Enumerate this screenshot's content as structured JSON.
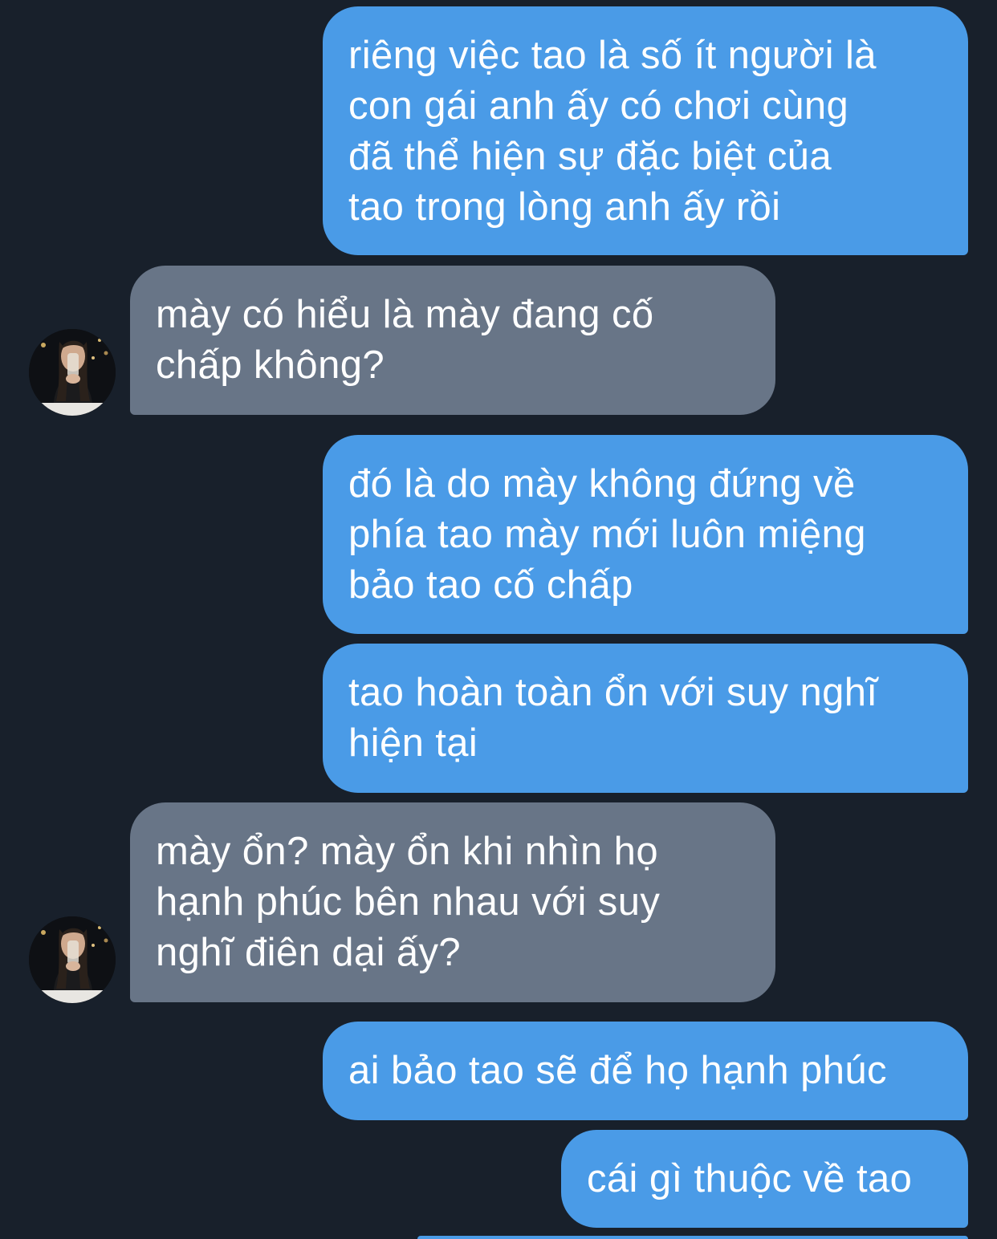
{
  "colors": {
    "background": "#18202b",
    "sent_bubble": "#4a9be7",
    "received_bubble": "#687587",
    "text": "#ffffff"
  },
  "messages": [
    {
      "direction": "sent",
      "text": "riêng việc tao là số ít người là\ncon gái anh ấy có chơi cùng\nđã thể hiện sự đặc biệt của\ntao trong lòng anh ấy rồi"
    },
    {
      "direction": "received",
      "text": "mày có hiểu là mày đang cố\nchấp không?"
    },
    {
      "direction": "sent",
      "text": "đó là do mày không đứng về\nphía tao mày mới luôn miệng\nbảo tao cố chấp"
    },
    {
      "direction": "sent",
      "text": "tao hoàn toàn ổn với suy nghĩ\nhiện tại"
    },
    {
      "direction": "received",
      "text": "mày ổn? mày ổn khi nhìn họ\nhạnh phúc bên nhau với suy\nnghĩ điên dại ấy?"
    },
    {
      "direction": "sent",
      "text": "ai bảo tao sẽ để họ hạnh phúc"
    },
    {
      "direction": "sent",
      "text": "cái gì thuộc về tao"
    }
  ]
}
